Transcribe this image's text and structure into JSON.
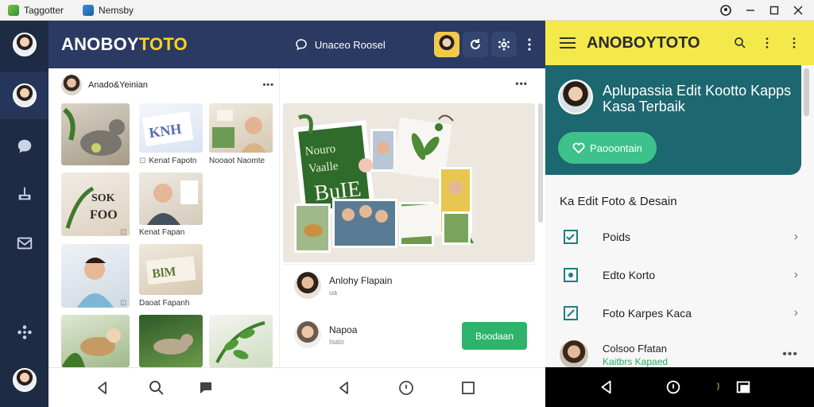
{
  "titlebar": {
    "tabs": [
      {
        "label": "Taggotter",
        "icon": "green-app-icon"
      },
      {
        "label": "Nemsby",
        "icon": "blue-app-icon"
      }
    ],
    "controls": [
      "account-icon",
      "minimize-icon",
      "maximize-icon",
      "close-icon"
    ]
  },
  "rail": {
    "items": [
      {
        "icon": "profile-avatar"
      },
      {
        "icon": "profile-avatar-active"
      },
      {
        "icon": "chat-icon"
      },
      {
        "icon": "share-icon"
      },
      {
        "icon": "mail-icon"
      },
      {
        "icon": "network-icon"
      },
      {
        "icon": "user-avatar"
      }
    ]
  },
  "header": {
    "brand_main": "ANOBOY",
    "brand_accent": "TOTO",
    "search_label": "Unaceo Roosel"
  },
  "gallery": {
    "author": "Anado&Yeinian",
    "captions": [
      "Kenat Fapotn",
      "Nooaot Naomte",
      "Kenat Fapan",
      "Daoat Fapanh"
    ]
  },
  "feed": {
    "board_texts": [
      "Nouro",
      "Vaalle",
      "BuIE"
    ],
    "posts": [
      {
        "name": "Anlohy Flapain",
        "sub": "ua"
      },
      {
        "name": "Napoa",
        "sub": "Isalo"
      }
    ],
    "cta_label": "Boodaan"
  },
  "right": {
    "brand": "ANOBOYTOTO",
    "hero_title": "Aplupassia Edit Kootto Kapps Kasa Terbaik",
    "hero_button": "Paooontain",
    "section_title": "Ka Edit Foto & Desain",
    "rows": [
      {
        "label": "Poids",
        "icon": "checkbox-icon"
      },
      {
        "label": "Edto Korto",
        "icon": "image-edit-icon"
      },
      {
        "label": "Foto Karpes Kaca",
        "icon": "edit-square-icon"
      }
    ],
    "contact": {
      "name": "Colsoo Ffatan",
      "sub": "Kaitbrs Kapaed"
    }
  },
  "colors": {
    "rail": "#1e2b44",
    "header": "#2a3a62",
    "brand_accent": "#ffd21f",
    "right_header": "#f4e94a",
    "hero": "#1c6770",
    "green": "#2fb36b"
  }
}
